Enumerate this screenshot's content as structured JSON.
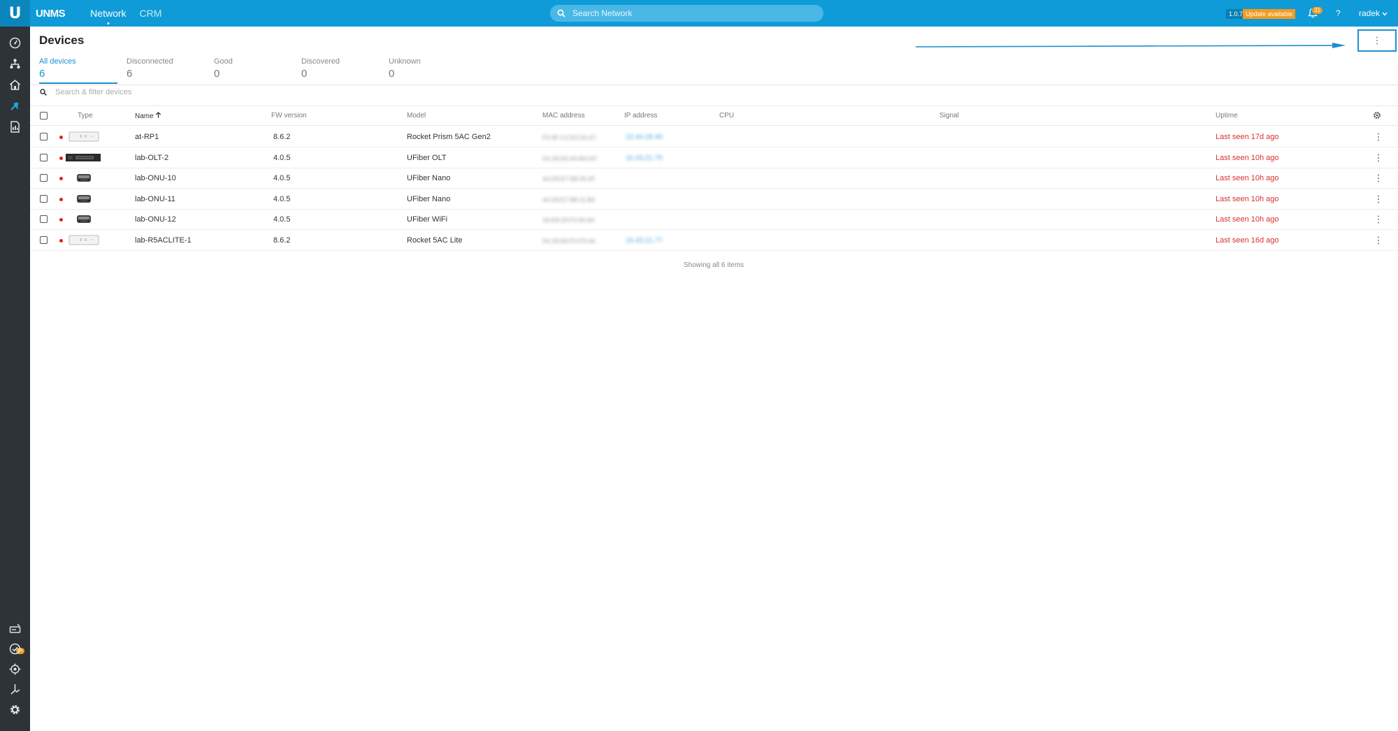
{
  "app": {
    "brand": "UNMS",
    "logo_letter": "U",
    "nav_tabs": [
      "Network",
      "CRM"
    ],
    "search_placeholder": "Search Network",
    "version": "1.0.7",
    "update_label": "Update available",
    "notifications_count": "31",
    "help_label": "?",
    "user": "radek",
    "sidebar_badge": "9+"
  },
  "page": {
    "title": "Devices"
  },
  "status_tabs": [
    {
      "label": "All devices",
      "count": "6"
    },
    {
      "label": "Disconnected",
      "count": "6"
    },
    {
      "label": "Good",
      "count": "0"
    },
    {
      "label": "Discovered",
      "count": "0"
    },
    {
      "label": "Unknown",
      "count": "0"
    }
  ],
  "filter": {
    "placeholder": "Search & filter devices"
  },
  "columns": {
    "type": "Type",
    "name": "Name",
    "fw": "FW version",
    "model": "Model",
    "mac": "MAC address",
    "ip": "IP address",
    "cpu": "CPU",
    "signal": "Signal",
    "uptime": "Uptime"
  },
  "devices": [
    {
      "name": "at-RP1",
      "fw": "8.6.2",
      "model": "Rocket Prism 5AC Gen2",
      "mac": "F0:9F:C2:E0:00:A7",
      "ip": "10.44.29.40",
      "uptime": "Last seen 17d ago",
      "image": "rocket"
    },
    {
      "name": "lab-OLT-2",
      "fw": "4.0.5",
      "model": "UFiber OLT",
      "mac": "04:18:D6:A0:B4:DC",
      "ip": "10.43.21.70",
      "uptime": "Last seen 10h ago",
      "image": "olt"
    },
    {
      "name": "lab-ONU-10",
      "fw": "4.0.5",
      "model": "UFiber Nano",
      "mac": "44:D9:E7:88:05:2F",
      "ip": "",
      "uptime": "Last seen 10h ago",
      "image": "onu"
    },
    {
      "name": "lab-ONU-11",
      "fw": "4.0.5",
      "model": "UFiber Nano",
      "mac": "44:D9:E7:88:11:B4",
      "ip": "",
      "uptime": "Last seen 10h ago",
      "image": "onu"
    },
    {
      "name": "lab-ONU-12",
      "fw": "4.0.5",
      "model": "UFiber WiFi",
      "mac": "18:E8:29:F0:00:6A",
      "ip": "",
      "uptime": "Last seen 10h ago",
      "image": "onu"
    },
    {
      "name": "lab-R5ACLITE-1",
      "fw": "8.6.2",
      "model": "Rocket 5AC Lite",
      "mac": "04:18:D6:F0:F9:4A",
      "ip": "10.43.21.77",
      "uptime": "Last seen 16d ago",
      "image": "rocket"
    }
  ],
  "footer": {
    "note": "Showing all 6 items"
  },
  "colors": {
    "topbar": "#0f9bd7",
    "sidebar": "#2d3337",
    "accent": "#1a8fd4",
    "offline": "#d9302f",
    "update": "#f49b1d"
  }
}
